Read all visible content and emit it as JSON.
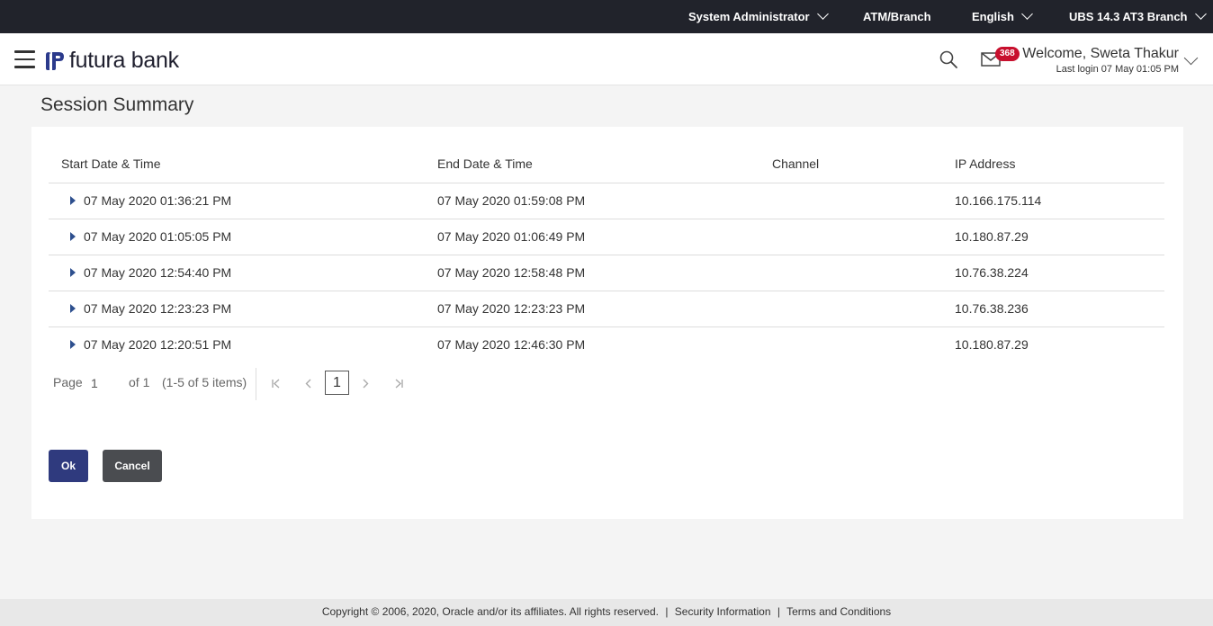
{
  "topbar": {
    "role": "System Administrator",
    "atm_branch": "ATM/Branch",
    "language": "English",
    "branch": "UBS 14.3 AT3 Branch"
  },
  "header": {
    "brand": "futura bank",
    "notification_count": "368",
    "welcome": "Welcome, Sweta Thakur",
    "last_login": "Last login 07 May 01:05 PM",
    "icons": [
      "menu-icon",
      "search-icon",
      "mail-icon",
      "chevron-down-icon"
    ]
  },
  "page": {
    "title": "Session Summary"
  },
  "table": {
    "columns": [
      "Start Date & Time",
      "End Date & Time",
      "Channel",
      "IP Address"
    ],
    "rows": [
      {
        "start": "07 May 2020 01:36:21 PM",
        "end": "07 May 2020 01:59:08 PM",
        "channel": "",
        "ip": "10.166.175.114"
      },
      {
        "start": "07 May 2020 01:05:05 PM",
        "end": "07 May 2020 01:06:49 PM",
        "channel": "",
        "ip": "10.180.87.29"
      },
      {
        "start": "07 May 2020 12:54:40 PM",
        "end": "07 May 2020 12:58:48 PM",
        "channel": "",
        "ip": "10.76.38.224"
      },
      {
        "start": "07 May 2020 12:23:23 PM",
        "end": "07 May 2020 12:23:23 PM",
        "channel": "",
        "ip": "10.76.38.236"
      },
      {
        "start": "07 May 2020 12:20:51 PM",
        "end": "07 May 2020 12:46:30 PM",
        "channel": "",
        "ip": "10.180.87.29"
      }
    ]
  },
  "pagination": {
    "page_label": "Page",
    "page_value": "1",
    "of_label": "of 1",
    "items_label": "(1-5 of 5 items)",
    "current": "1"
  },
  "actions": {
    "ok": "Ok",
    "cancel": "Cancel"
  },
  "footer": {
    "copyright": "Copyright © 2006, 2020, Oracle and/or its affiliates. All rights reserved.",
    "security": "Security Information",
    "terms": "Terms and Conditions",
    "separator": "|"
  },
  "colors": {
    "topbar_bg": "#21232b",
    "primary_button": "#2f3a7e",
    "secondary_button": "#4a4c50",
    "badge": "#c8102e",
    "expand_arrow": "#2d4f8e"
  }
}
